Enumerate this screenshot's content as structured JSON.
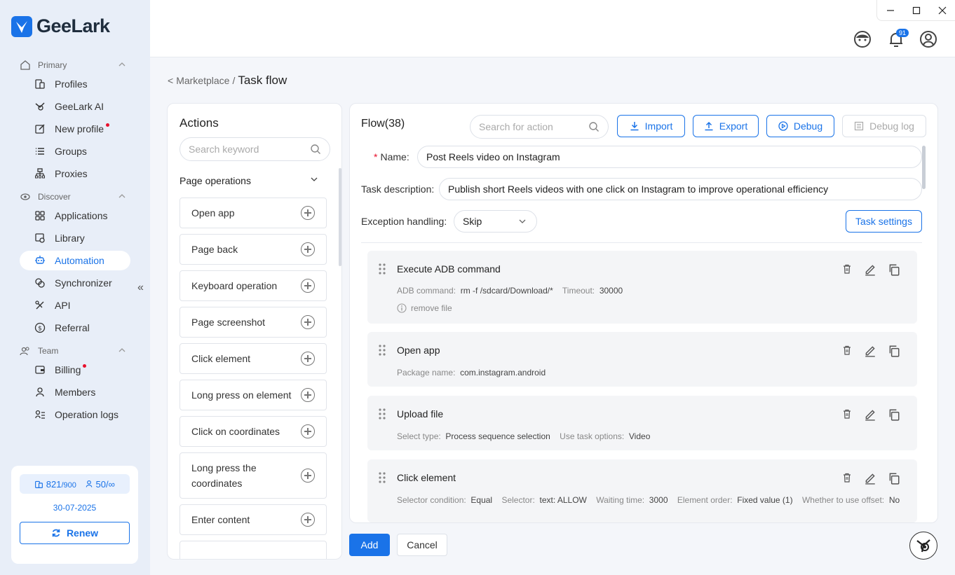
{
  "app": {
    "name": "GeeLark"
  },
  "sidebar": {
    "sections": [
      {
        "label": "Primary"
      },
      {
        "label": "Discover"
      },
      {
        "label": "Team"
      }
    ],
    "items": [
      {
        "label": "Profiles",
        "icon": "profiles-icon"
      },
      {
        "label": "GeeLark AI",
        "icon": "ai-icon"
      },
      {
        "label": "New profile",
        "icon": "new-profile-icon",
        "dot": true
      },
      {
        "label": "Groups",
        "icon": "groups-icon"
      },
      {
        "label": "Proxies",
        "icon": "proxies-icon"
      },
      {
        "label": "Applications",
        "icon": "applications-icon"
      },
      {
        "label": "Library",
        "icon": "library-icon"
      },
      {
        "label": "Automation",
        "icon": "automation-icon",
        "active": true
      },
      {
        "label": "Synchronizer",
        "icon": "synchronizer-icon"
      },
      {
        "label": "API",
        "icon": "api-icon"
      },
      {
        "label": "Referral",
        "icon": "referral-icon"
      },
      {
        "label": "Billing",
        "icon": "billing-icon",
        "dot": true
      },
      {
        "label": "Members",
        "icon": "members-icon"
      },
      {
        "label": "Operation logs",
        "icon": "operation-logs-icon"
      }
    ],
    "card": {
      "profiles_used": "821",
      "profiles_total": "/900",
      "members_used": "50",
      "members_total": "/∞",
      "date": "30-07-2025",
      "renew_label": "Renew"
    }
  },
  "header": {
    "notification_count": "91"
  },
  "breadcrumb": {
    "back": "<",
    "parent": "Marketplace",
    "sep": "/",
    "current": "Task flow"
  },
  "actions_panel": {
    "title": "Actions",
    "search_placeholder": "Search keyword",
    "group": "Page operations",
    "items": [
      {
        "label": "Open app"
      },
      {
        "label": "Page back"
      },
      {
        "label": "Keyboard operation"
      },
      {
        "label": "Page screenshot"
      },
      {
        "label": "Click element"
      },
      {
        "label": "Long press on element"
      },
      {
        "label": "Click on coordinates"
      },
      {
        "label": "Long press the coordinates"
      },
      {
        "label": "Enter content"
      }
    ]
  },
  "flow": {
    "title": "Flow(38)",
    "search_placeholder": "Search for action",
    "import_label": "Import",
    "export_label": "Export",
    "debug_label": "Debug",
    "debug_log_label": "Debug log",
    "name_label": "Name",
    "name_value": "Post Reels video on Instagram",
    "desc_label": "Task description",
    "desc_value": "Publish short Reels videos with one click on Instagram to improve operational efficiency",
    "exception_label": "Exception handling",
    "exception_value": "Skip",
    "task_settings_label": "Task settings",
    "steps": [
      {
        "title": "Execute ADB command",
        "meta": [
          [
            "ADB command",
            "rm -f /sdcard/Download/*"
          ],
          [
            "Timeout",
            "30000"
          ]
        ],
        "note": "remove file"
      },
      {
        "title": "Open app",
        "meta": [
          [
            "Package name",
            "com.instagram.android"
          ]
        ]
      },
      {
        "title": "Upload file",
        "meta": [
          [
            "Select type",
            "Process sequence selection"
          ],
          [
            "Use task options",
            "Video"
          ]
        ]
      },
      {
        "title": "Click element",
        "meta": [
          [
            "Selector condition",
            "Equal"
          ],
          [
            "Selector",
            "text:  ALLOW"
          ],
          [
            "Waiting time",
            "3000"
          ],
          [
            "Element order",
            "Fixed value (1)"
          ],
          [
            "Whether to use offset",
            "No"
          ]
        ]
      }
    ]
  },
  "footer": {
    "add_label": "Add",
    "cancel_label": "Cancel"
  },
  "colors": {
    "accent": "#1a73e8",
    "sidebar_bg": "#e8eef8",
    "dot": "#e8102c"
  }
}
